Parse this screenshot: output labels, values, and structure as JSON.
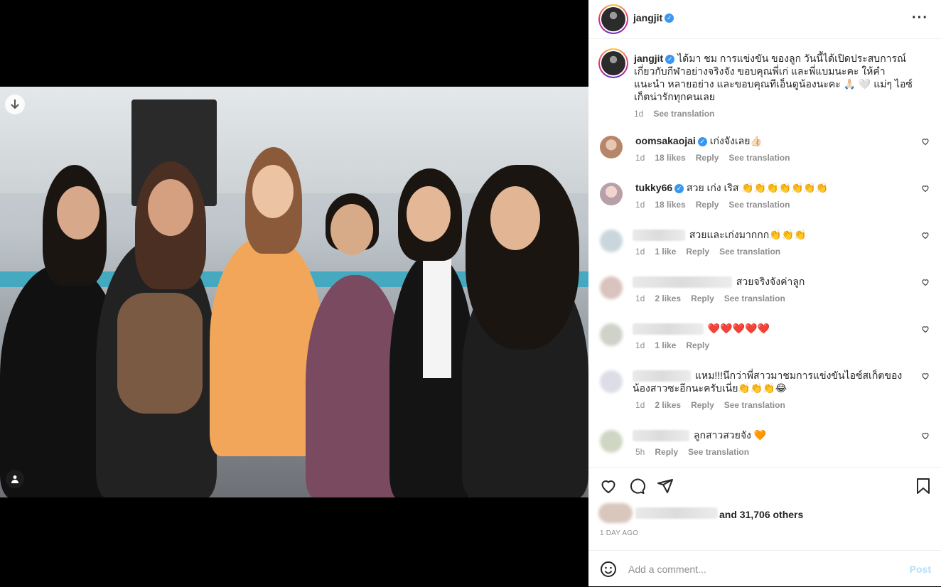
{
  "post": {
    "username": "jangjit",
    "caption": "ได้มา ชม การแข่งขัน ของลูก วันนี้ได้เปิดประสบการณ์ เกี่ยวกับกีฬาอย่างจริงจัง ขอบคุณพี่เก่ และพี่แบมนะคะ ให้คำแนะนำ หลายอย่าง และขอบคุณทีเอ็นดูน้องนะคะ 🙏🏻 🤍 แม่ๆ ไอซ์เก็ตน่ารักทุกคนเลย",
    "caption_time": "1d",
    "see_translation": "See translation"
  },
  "comments": [
    {
      "user": "oomsakaojai",
      "verified": true,
      "text": "เก่งจังเลย👍🏻",
      "time": "1d",
      "likes": "18 likes",
      "reply": "Reply",
      "translate": "See translation"
    },
    {
      "user": "tukky66",
      "verified": true,
      "text": "สวย เก่ง เริส 👏👏👏👏👏👏👏",
      "time": "1d",
      "likes": "18 likes",
      "reply": "Reply",
      "translate": "See translation"
    },
    {
      "user": "",
      "verified": false,
      "text": "สวยและเก่งมากกก👏👏👏",
      "time": "1d",
      "likes": "1 like",
      "reply": "Reply",
      "translate": "See translation"
    },
    {
      "user": "",
      "verified": false,
      "text": "สวยจริงจังค่าลูก",
      "time": "1d",
      "likes": "2 likes",
      "reply": "Reply",
      "translate": "See translation"
    },
    {
      "user": "",
      "verified": false,
      "text": "❤️❤️❤️❤️❤️",
      "time": "1d",
      "likes": "1 like",
      "reply": "Reply",
      "translate": ""
    },
    {
      "user": "",
      "verified": false,
      "text": "แหม!!!นึกว่าพี่สาวมาชมการแข่งขันไอซ์สเก็ตของน้องสาวซะอีกนะครับเนี่ย👏👏👏😂",
      "time": "1d",
      "likes": "2 likes",
      "reply": "Reply",
      "translate": "See translation"
    },
    {
      "user": "",
      "verified": false,
      "text": "ลูกสาวสวยจัง 🧡",
      "time": "5h",
      "likes": "",
      "reply": "Reply",
      "translate": "See translation"
    }
  ],
  "likes_text": "and 31,706 others",
  "time_ago": "1 DAY AGO",
  "add_comment": {
    "placeholder": "Add a comment...",
    "post_label": "Post"
  },
  "icons": {
    "more": "more-options-icon",
    "like": "heart-icon",
    "comment": "comment-icon",
    "share": "share-icon",
    "save": "bookmark-icon",
    "emoji": "emoji-icon",
    "download": "download-icon",
    "tag": "user-tag-icon"
  },
  "colors": {
    "link": "#3897f0",
    "post_disabled": "#b2dffc",
    "meta": "#8e8e8e"
  }
}
